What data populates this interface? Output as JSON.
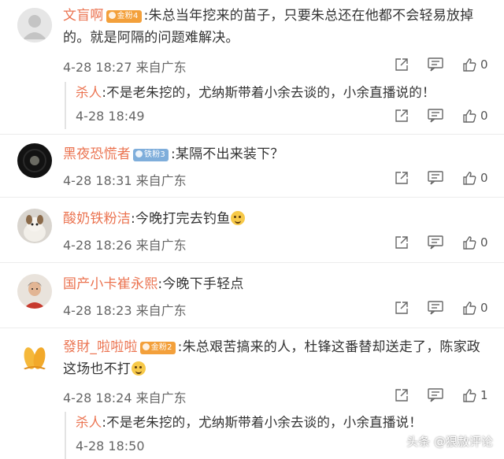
{
  "comments": [
    {
      "user": "文盲啊",
      "badge": "金粉4",
      "text1": ":朱总当年挖来的苗子，只要朱总还在他都不会轻易放掉",
      "text2": "的。就是阿隔的问题难解决。",
      "time": "4-28 18:27",
      "source": "来自广东",
      "likes": "0",
      "reply": {
        "user": "杀人",
        "text": ":不是老朱挖的，尤纳斯带着小余去谈的，小余直播说的！",
        "time": "4-28 18:49",
        "likes": "0"
      }
    },
    {
      "user": "黑夜恐慌者",
      "badge": "铁粉3",
      "text1": ":某隔不出来装下？",
      "time": "4-28 18:31",
      "source": "来自广东",
      "likes": "0"
    },
    {
      "user": "酸奶铁粉洁",
      "text1": ":今晚打完去钓鱼",
      "time": "4-28 18:26",
      "source": "来自广东",
      "likes": "0"
    },
    {
      "user": "国产小卡崔永熙",
      "text1": ":今晚下手轻点",
      "time": "4-28 18:23",
      "source": "来自广东",
      "likes": "0"
    },
    {
      "user": "發財_啦啦啦",
      "badge": "金粉2",
      "text1": ":朱总艰苦搞来的人，杜锋这番替却送走了，陈家政",
      "text2": "这场也不打",
      "time": "4-28 18:24",
      "source": "来自广东",
      "likes": "1",
      "reply": {
        "user": "杀人",
        "text": ":不是老朱挖的，尤纳斯带着小余去谈的，小余直播说！",
        "time": "4-28 18:50"
      }
    }
  ],
  "watermark": "头条 @狠赦评论",
  "colors": {
    "username": "#eb7350",
    "gold_badge": "#f3a03b",
    "iron_badge": "#7faedb"
  },
  "icons": [
    "share-icon",
    "comment-icon",
    "like-icon"
  ]
}
